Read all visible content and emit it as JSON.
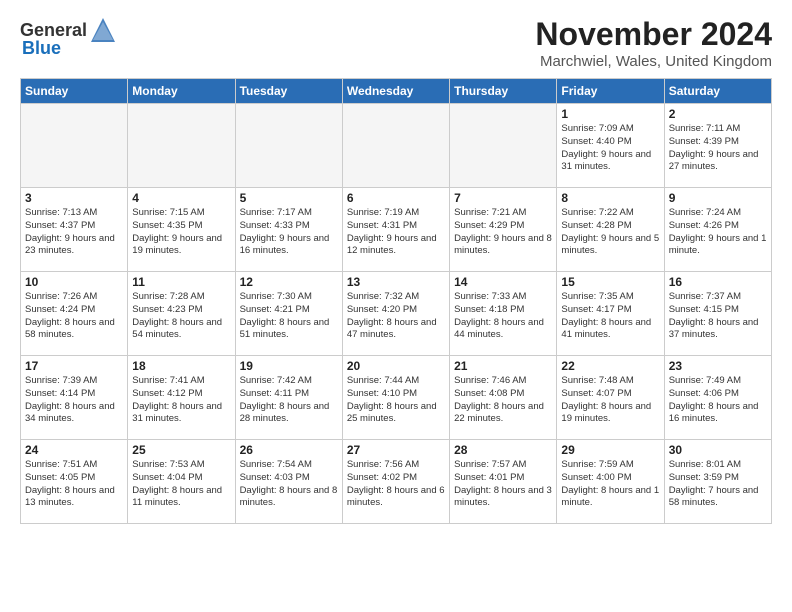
{
  "logo": {
    "general": "General",
    "blue": "Blue"
  },
  "header": {
    "month_title": "November 2024",
    "location": "Marchwiel, Wales, United Kingdom"
  },
  "weekdays": [
    "Sunday",
    "Monday",
    "Tuesday",
    "Wednesday",
    "Thursday",
    "Friday",
    "Saturday"
  ],
  "weeks": [
    [
      {
        "day": "",
        "info": ""
      },
      {
        "day": "",
        "info": ""
      },
      {
        "day": "",
        "info": ""
      },
      {
        "day": "",
        "info": ""
      },
      {
        "day": "",
        "info": ""
      },
      {
        "day": "1",
        "info": "Sunrise: 7:09 AM\nSunset: 4:40 PM\nDaylight: 9 hours and 31 minutes."
      },
      {
        "day": "2",
        "info": "Sunrise: 7:11 AM\nSunset: 4:39 PM\nDaylight: 9 hours and 27 minutes."
      }
    ],
    [
      {
        "day": "3",
        "info": "Sunrise: 7:13 AM\nSunset: 4:37 PM\nDaylight: 9 hours and 23 minutes."
      },
      {
        "day": "4",
        "info": "Sunrise: 7:15 AM\nSunset: 4:35 PM\nDaylight: 9 hours and 19 minutes."
      },
      {
        "day": "5",
        "info": "Sunrise: 7:17 AM\nSunset: 4:33 PM\nDaylight: 9 hours and 16 minutes."
      },
      {
        "day": "6",
        "info": "Sunrise: 7:19 AM\nSunset: 4:31 PM\nDaylight: 9 hours and 12 minutes."
      },
      {
        "day": "7",
        "info": "Sunrise: 7:21 AM\nSunset: 4:29 PM\nDaylight: 9 hours and 8 minutes."
      },
      {
        "day": "8",
        "info": "Sunrise: 7:22 AM\nSunset: 4:28 PM\nDaylight: 9 hours and 5 minutes."
      },
      {
        "day": "9",
        "info": "Sunrise: 7:24 AM\nSunset: 4:26 PM\nDaylight: 9 hours and 1 minute."
      }
    ],
    [
      {
        "day": "10",
        "info": "Sunrise: 7:26 AM\nSunset: 4:24 PM\nDaylight: 8 hours and 58 minutes."
      },
      {
        "day": "11",
        "info": "Sunrise: 7:28 AM\nSunset: 4:23 PM\nDaylight: 8 hours and 54 minutes."
      },
      {
        "day": "12",
        "info": "Sunrise: 7:30 AM\nSunset: 4:21 PM\nDaylight: 8 hours and 51 minutes."
      },
      {
        "day": "13",
        "info": "Sunrise: 7:32 AM\nSunset: 4:20 PM\nDaylight: 8 hours and 47 minutes."
      },
      {
        "day": "14",
        "info": "Sunrise: 7:33 AM\nSunset: 4:18 PM\nDaylight: 8 hours and 44 minutes."
      },
      {
        "day": "15",
        "info": "Sunrise: 7:35 AM\nSunset: 4:17 PM\nDaylight: 8 hours and 41 minutes."
      },
      {
        "day": "16",
        "info": "Sunrise: 7:37 AM\nSunset: 4:15 PM\nDaylight: 8 hours and 37 minutes."
      }
    ],
    [
      {
        "day": "17",
        "info": "Sunrise: 7:39 AM\nSunset: 4:14 PM\nDaylight: 8 hours and 34 minutes."
      },
      {
        "day": "18",
        "info": "Sunrise: 7:41 AM\nSunset: 4:12 PM\nDaylight: 8 hours and 31 minutes."
      },
      {
        "day": "19",
        "info": "Sunrise: 7:42 AM\nSunset: 4:11 PM\nDaylight: 8 hours and 28 minutes."
      },
      {
        "day": "20",
        "info": "Sunrise: 7:44 AM\nSunset: 4:10 PM\nDaylight: 8 hours and 25 minutes."
      },
      {
        "day": "21",
        "info": "Sunrise: 7:46 AM\nSunset: 4:08 PM\nDaylight: 8 hours and 22 minutes."
      },
      {
        "day": "22",
        "info": "Sunrise: 7:48 AM\nSunset: 4:07 PM\nDaylight: 8 hours and 19 minutes."
      },
      {
        "day": "23",
        "info": "Sunrise: 7:49 AM\nSunset: 4:06 PM\nDaylight: 8 hours and 16 minutes."
      }
    ],
    [
      {
        "day": "24",
        "info": "Sunrise: 7:51 AM\nSunset: 4:05 PM\nDaylight: 8 hours and 13 minutes."
      },
      {
        "day": "25",
        "info": "Sunrise: 7:53 AM\nSunset: 4:04 PM\nDaylight: 8 hours and 11 minutes."
      },
      {
        "day": "26",
        "info": "Sunrise: 7:54 AM\nSunset: 4:03 PM\nDaylight: 8 hours and 8 minutes."
      },
      {
        "day": "27",
        "info": "Sunrise: 7:56 AM\nSunset: 4:02 PM\nDaylight: 8 hours and 6 minutes."
      },
      {
        "day": "28",
        "info": "Sunrise: 7:57 AM\nSunset: 4:01 PM\nDaylight: 8 hours and 3 minutes."
      },
      {
        "day": "29",
        "info": "Sunrise: 7:59 AM\nSunset: 4:00 PM\nDaylight: 8 hours and 1 minute."
      },
      {
        "day": "30",
        "info": "Sunrise: 8:01 AM\nSunset: 3:59 PM\nDaylight: 7 hours and 58 minutes."
      }
    ]
  ]
}
